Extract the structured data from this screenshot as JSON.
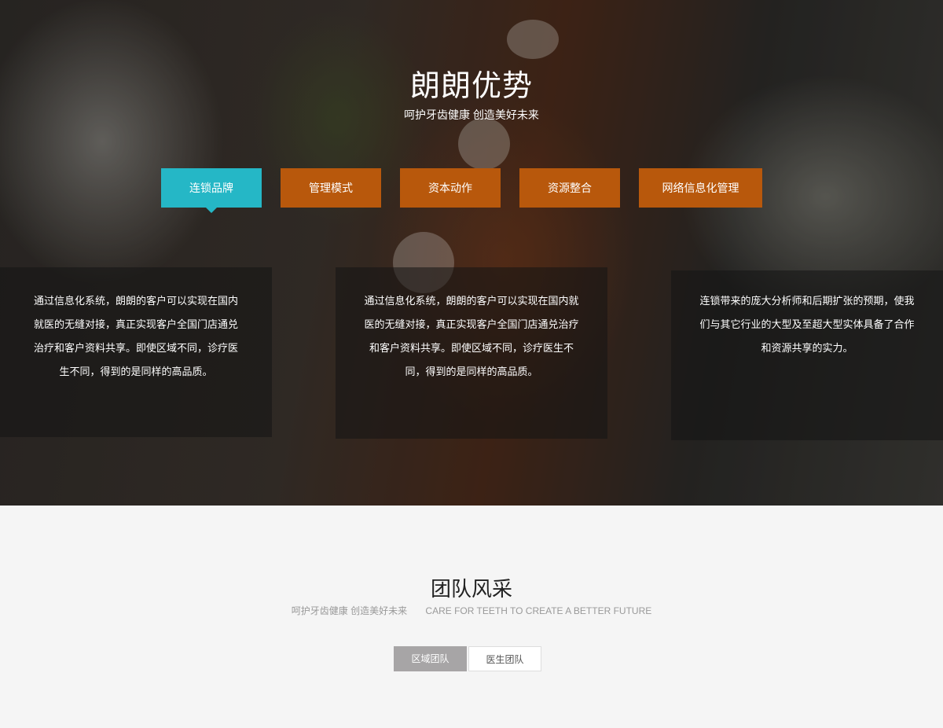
{
  "advantage": {
    "title": "朗朗优势",
    "subtitle": "呵护牙齿健康 创造美好未来",
    "tabs": [
      {
        "label": "连锁品牌",
        "active": true
      },
      {
        "label": "管理模式",
        "active": false
      },
      {
        "label": "资本动作",
        "active": false
      },
      {
        "label": "资源整合",
        "active": false
      },
      {
        "label": "网络信息化管理",
        "active": false
      }
    ],
    "panels": [
      {
        "text": "通过信息化系统，朗朗的客户可以实现在国内就医的无缝对接，真正实现客户全国门店通兑治疗和客户资料共享。即使区域不同，诊疗医生不同，得到的是同样的高品质。"
      },
      {
        "text": "通过信息化系统，朗朗的客户可以实现在国内就医的无缝对接，真正实现客户全国门店通兑治疗和客户资料共享。即使区域不同，诊疗医生不同，得到的是同样的高品质。"
      },
      {
        "text": "连锁带来的庞大分析师和后期扩张的预期，使我们与其它行业的大型及至超大型实体具备了合作和资源共享的实力。"
      }
    ]
  },
  "team": {
    "title": "团队风采",
    "subtitle_cn": "呵护牙齿健康  创造美好未来",
    "subtitle_en": "CARE FOR TEETH TO CREATE A BETTER FUTURE",
    "buttons": [
      {
        "label": "区域团队",
        "active": true
      },
      {
        "label": "医生团队",
        "active": false
      }
    ]
  },
  "colors": {
    "tab_active": "#25b7c6",
    "tab_normal": "#b8580c",
    "button_active": "#a7a5a6"
  }
}
